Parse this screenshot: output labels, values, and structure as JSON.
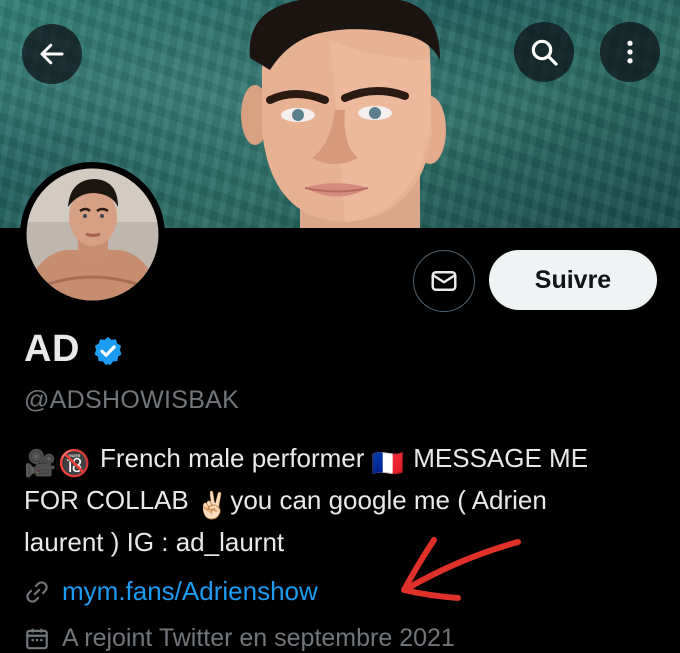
{
  "header": {
    "back_icon": "arrow-left-icon",
    "search_icon": "search-icon",
    "more_icon": "more-vertical-icon"
  },
  "profile": {
    "display_name": "AD",
    "verified": true,
    "handle": "@ADSHOWISBAK",
    "bio": {
      "emoji_1": "🎥",
      "emoji_2": "🔞",
      "line_1_text": " French male performer ",
      "flag": "🇫🇷",
      "line_1_end": " MESSAGE ME",
      "line_2_text": "FOR COLLAB ",
      "victory": "✌🏻",
      "line_2_end": "you can google me ( Adrien",
      "line_3": "laurent ) IG : ad_laurnt"
    },
    "link": "mym.fans/Adrienshow",
    "joined": "A rejoint Twitter en septembre 2021"
  },
  "actions": {
    "follow_label": "Suivre",
    "message_icon": "envelope-icon"
  },
  "colors": {
    "background": "#000000",
    "text": "#e7e9ea",
    "muted": "#71767b",
    "link": "#1d9bf0",
    "verified": "#1d9bf0",
    "annotation_arrow": "#e0302a"
  }
}
